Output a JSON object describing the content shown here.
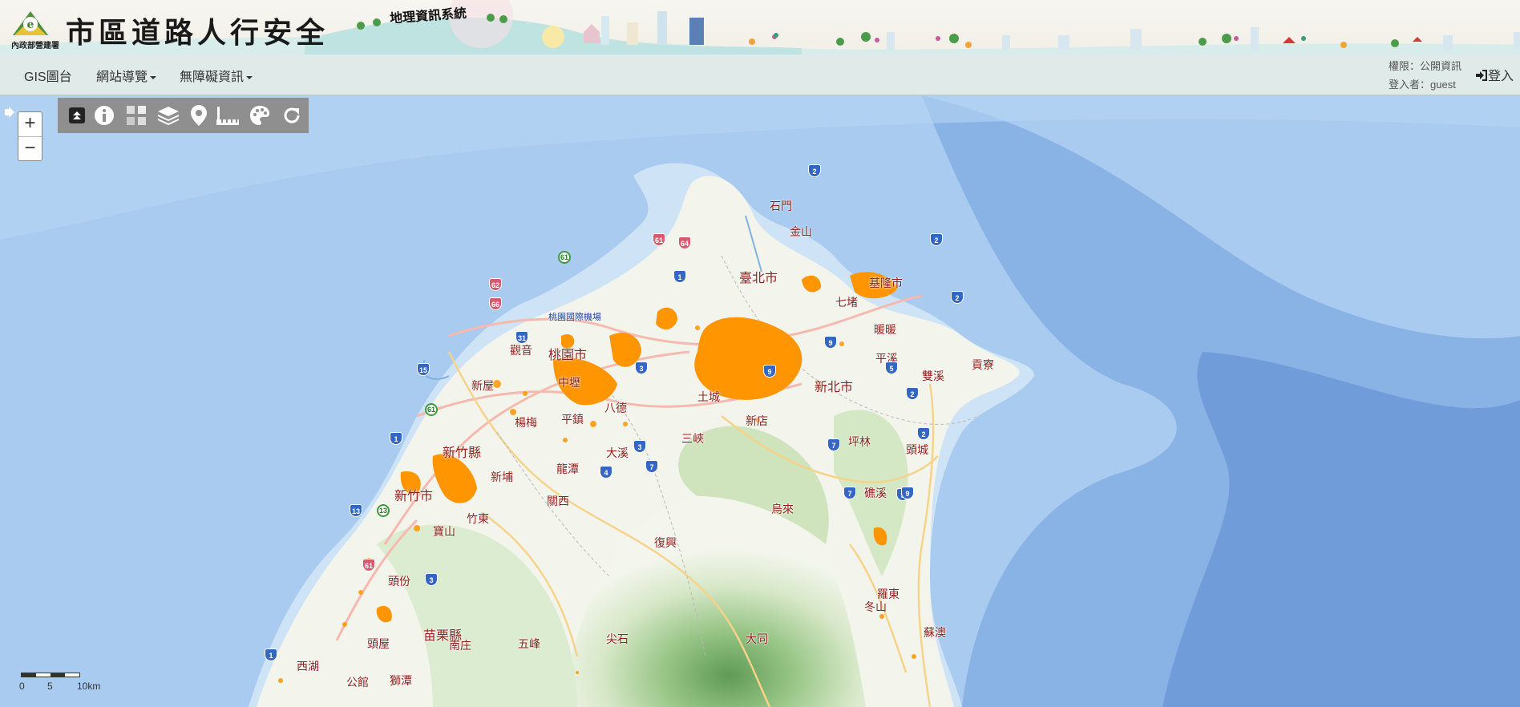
{
  "header": {
    "agency_logo_label": "內政部營建署",
    "site_title": "市區道路人行安全",
    "site_subtitle": "地理資訊系統"
  },
  "navbar": {
    "items": [
      {
        "label": "GIS圖台",
        "dropdown": false
      },
      {
        "label": "網站導覽",
        "dropdown": true
      },
      {
        "label": "無障礙資訊",
        "dropdown": true
      }
    ],
    "permission_text": "權限：公開資訊",
    "login_user_text": "登入者：guest",
    "login_label": "登入"
  },
  "map": {
    "zoom_in": "+",
    "zoom_out": "−",
    "toolbar_icons": [
      "collapse-icon",
      "info-icon",
      "query-grid-icon",
      "layers-icon",
      "location-pin-icon",
      "ruler-icon",
      "palette-icon",
      "refresh-icon"
    ],
    "scale_labels": [
      "0",
      "5",
      "10km"
    ],
    "places": [
      "石門",
      "金山",
      "臺北市",
      "基隆市",
      "七堵",
      "暖暖",
      "平溪",
      "雙溪",
      "貢寮",
      "觀音",
      "桃園市",
      "新屋",
      "中壢",
      "八德",
      "土城",
      "新北市",
      "楊梅",
      "平鎮",
      "三峽",
      "新店",
      "坪林",
      "頭城",
      "新竹縣",
      "大溪",
      "新埔",
      "龍潭",
      "關西",
      "竹東",
      "新竹市",
      "烏來",
      "復興",
      "礁溪",
      "羅東",
      "冬山",
      "寶山",
      "苗栗縣",
      "頭份",
      "南庄",
      "五峰",
      "尖石",
      "大同",
      "蘇澳",
      "頭屋",
      "西湖",
      "公館",
      "獅潭",
      "桃園國際機場"
    ],
    "route_shields": [
      "2",
      "2",
      "2",
      "2",
      "2",
      "9",
      "9",
      "61",
      "62",
      "64",
      "66",
      "31",
      "15",
      "1",
      "1",
      "3",
      "3",
      "3",
      "4",
      "5",
      "7",
      "7",
      "7",
      "9",
      "9",
      "13",
      "13",
      "61",
      "61",
      "61",
      "1"
    ],
    "colors": {
      "sea": "#a5c9ee",
      "land": "#f4f6ee",
      "forest": "#9bc78a",
      "overlay": "#ff9500",
      "toolbar": "#8f8f8f",
      "navbar": "#dfeae9"
    }
  }
}
